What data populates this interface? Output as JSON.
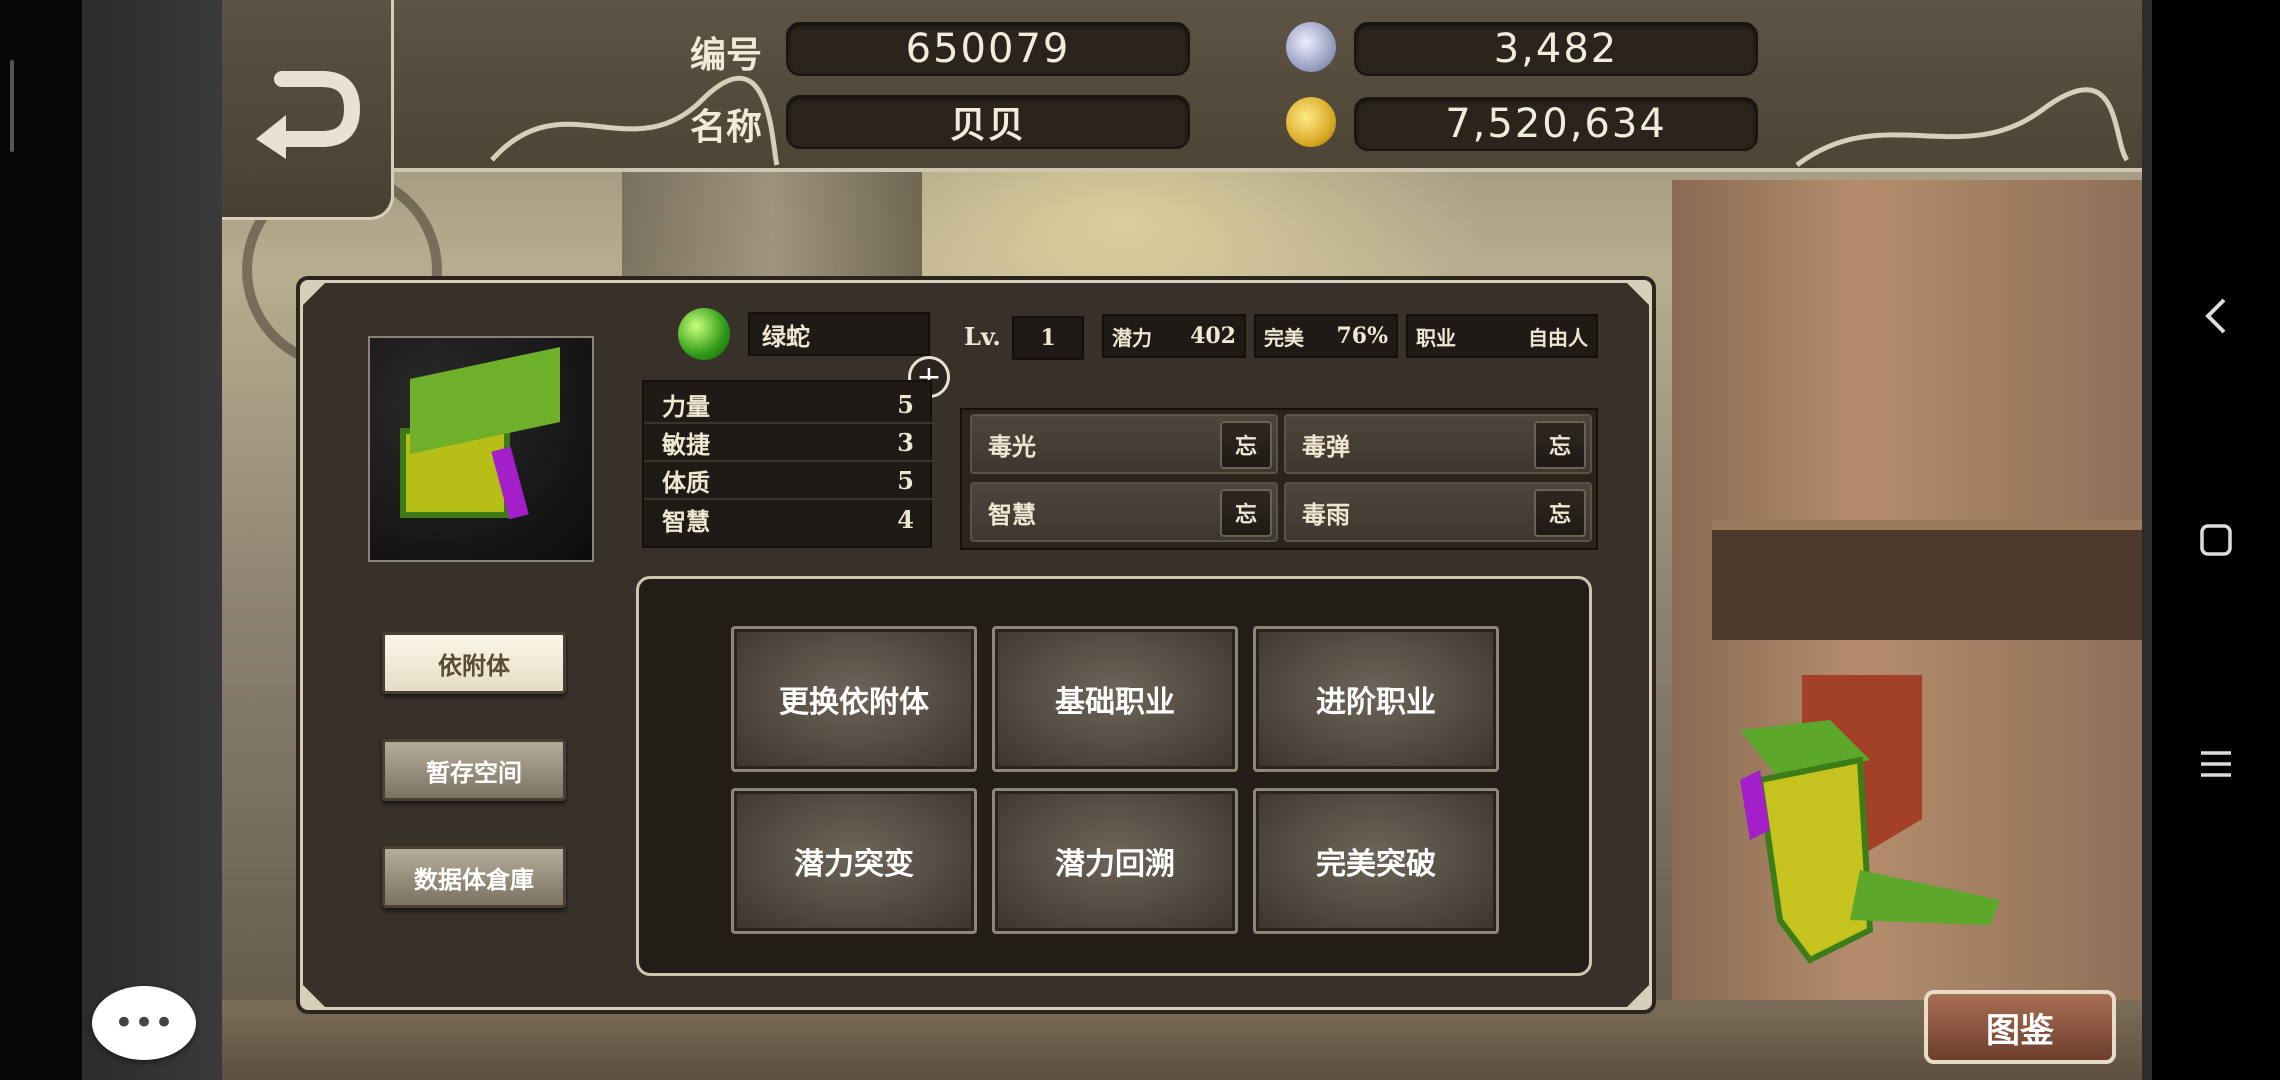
{
  "header": {
    "id_label": "编号",
    "id_value": "650079",
    "name_label": "名称",
    "name_value": "贝贝",
    "currency_1": "3,482",
    "currency_2": "7,520,634"
  },
  "pet": {
    "species": "绿蛇",
    "level_label": "Lv.",
    "level": "1",
    "potential_label": "潜力",
    "potential": "402",
    "perfect_label": "完美",
    "perfect": "76%",
    "job_label": "职业",
    "job": "自由人"
  },
  "attributes": [
    {
      "label": "力量",
      "value": "5"
    },
    {
      "label": "敏捷",
      "value": "3"
    },
    {
      "label": "体质",
      "value": "5"
    },
    {
      "label": "智慧",
      "value": "4"
    }
  ],
  "skills": [
    {
      "name": "毒光",
      "forget": "忘"
    },
    {
      "name": "毒弹",
      "forget": "忘"
    },
    {
      "name": "智慧",
      "forget": "忘"
    },
    {
      "name": "毒雨",
      "forget": "忘"
    }
  ],
  "side_menu": [
    "依附体",
    "暂存空间",
    "数据体倉庫"
  ],
  "actions": [
    "更换依附体",
    "基础职业",
    "进阶职业",
    "潜力突变",
    "潜力回溯",
    "完美突破"
  ],
  "codex_label": "图鉴",
  "chat_glyph": "•••",
  "plus_glyph": "+",
  "colors": {
    "panel": "#37312a",
    "accent_gold": "#d6b24a",
    "pet_green": "#4caf2a"
  },
  "icons": [
    "back-arrow-icon",
    "gem-icon",
    "gold-coin-icon",
    "green-orb-icon",
    "plus-icon",
    "chat-bubble-icon",
    "nav-back-icon",
    "nav-home-icon",
    "nav-menu-icon"
  ]
}
